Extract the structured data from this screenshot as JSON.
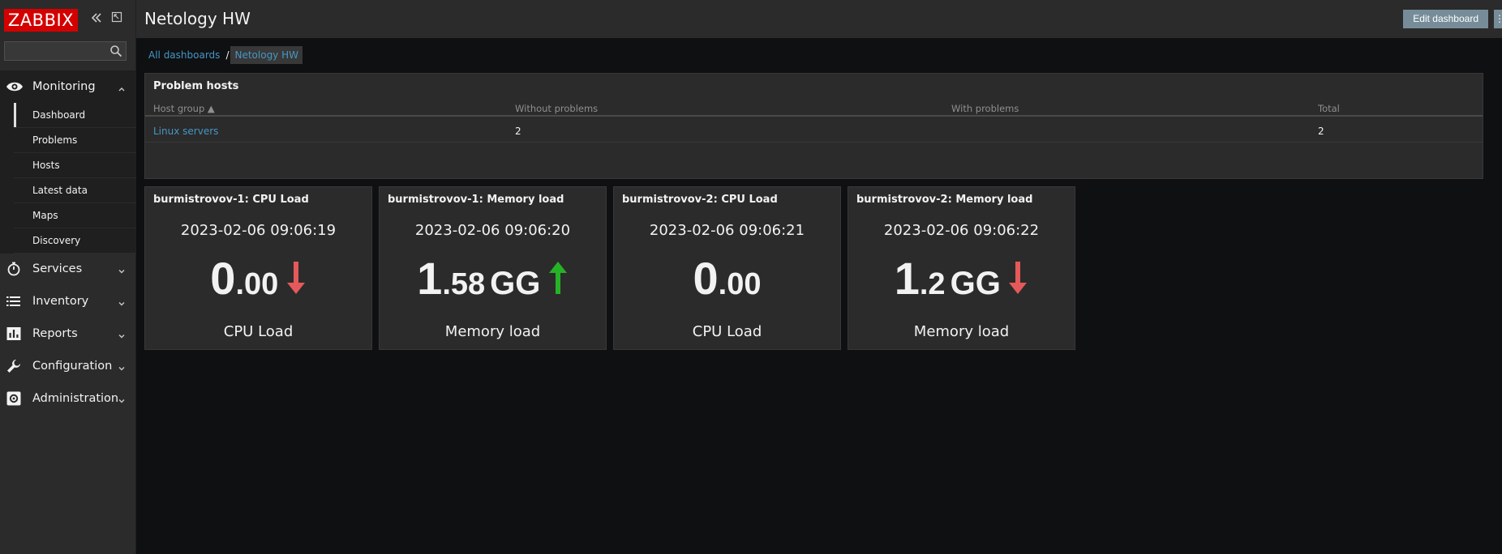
{
  "app": {
    "logo_text": "ZABBIX",
    "brand_color": "#d40000"
  },
  "sidebar": {
    "search": {
      "value": "",
      "placeholder": ""
    },
    "monitoring": {
      "label": "Monitoring",
      "items": [
        {
          "label": "Dashboard",
          "active": true
        },
        {
          "label": "Problems"
        },
        {
          "label": "Hosts"
        },
        {
          "label": "Latest data"
        },
        {
          "label": "Maps"
        },
        {
          "label": "Discovery"
        }
      ]
    },
    "sections": [
      {
        "label": "Services",
        "icon": "stopwatch-icon"
      },
      {
        "label": "Inventory",
        "icon": "list-icon"
      },
      {
        "label": "Reports",
        "icon": "bar-chart-icon"
      },
      {
        "label": "Configuration",
        "icon": "wrench-icon"
      },
      {
        "label": "Administration",
        "icon": "gear-icon"
      }
    ]
  },
  "header": {
    "title": "Netology HW",
    "edit_button": "Edit dashboard",
    "kebab": "⋮"
  },
  "breadcrumbs": {
    "root": "All dashboards",
    "separator": "/",
    "current": "Netology HW"
  },
  "problem_hosts": {
    "title": "Problem hosts",
    "columns": [
      "Host group ▲",
      "Without problems",
      "With problems",
      "Total"
    ],
    "rows": [
      {
        "group": "Linux servers",
        "without": "2",
        "with": "",
        "total": "2"
      }
    ]
  },
  "item_widgets": [
    {
      "title": "burmistrovov-1: CPU Load",
      "time": "2023-02-06 09:06:19",
      "int": "0",
      "dec": ".00",
      "units": "",
      "trend": "down",
      "desc": "CPU Load"
    },
    {
      "title": "burmistrovov-1: Memory load",
      "time": "2023-02-06 09:06:20",
      "int": "1",
      "dec": ".58",
      "units": "GG",
      "trend": "up",
      "desc": "Memory load"
    },
    {
      "title": "burmistrovov-2: CPU Load",
      "time": "2023-02-06 09:06:21",
      "int": "0",
      "dec": ".00",
      "units": "",
      "trend": "none",
      "desc": "CPU Load"
    },
    {
      "title": "burmistrovov-2: Memory load",
      "time": "2023-02-06 09:06:22",
      "int": "1",
      "dec": ".2",
      "units": "GG",
      "trend": "down",
      "desc": "Memory load"
    }
  ],
  "colors": {
    "trend_up": "#26b226",
    "trend_down": "#e45959",
    "link": "#4796c4"
  }
}
